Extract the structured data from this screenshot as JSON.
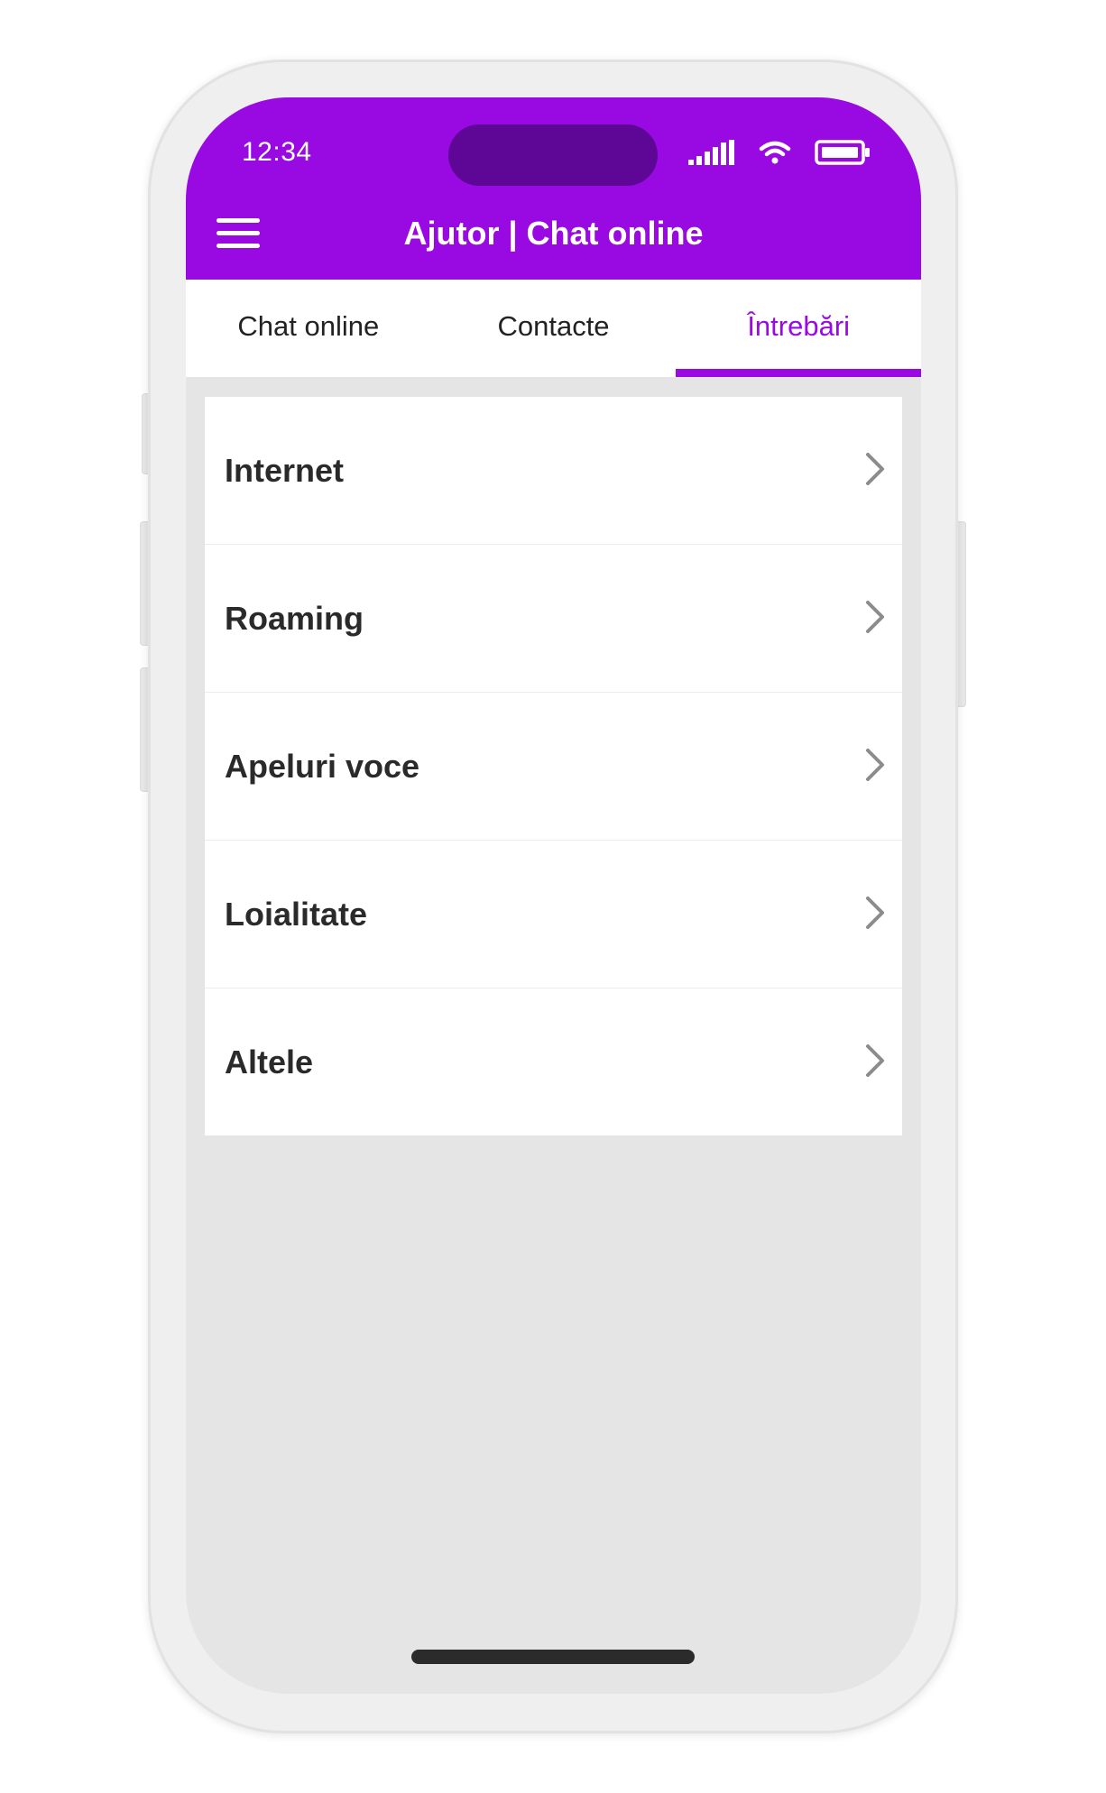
{
  "status_bar": {
    "time": "12:34",
    "icons": [
      "signal-icon",
      "wifi-icon",
      "battery-icon"
    ]
  },
  "header": {
    "menu_icon": "hamburger-menu-icon",
    "title": "Ajutor | Chat online"
  },
  "tabs": [
    {
      "label": "Chat online",
      "active": false
    },
    {
      "label": "Contacte",
      "active": false
    },
    {
      "label": "Întrebări",
      "active": true
    }
  ],
  "faq_categories": [
    {
      "label": "Internet"
    },
    {
      "label": "Roaming"
    },
    {
      "label": "Apeluri voce"
    },
    {
      "label": "Loialitate"
    },
    {
      "label": "Altele"
    }
  ],
  "colors": {
    "brand_purple": "#990ae3",
    "island": "#5e0796",
    "background": "#e5e5e5",
    "text": "#2a2a2a",
    "chevron": "#8c8c8c"
  }
}
